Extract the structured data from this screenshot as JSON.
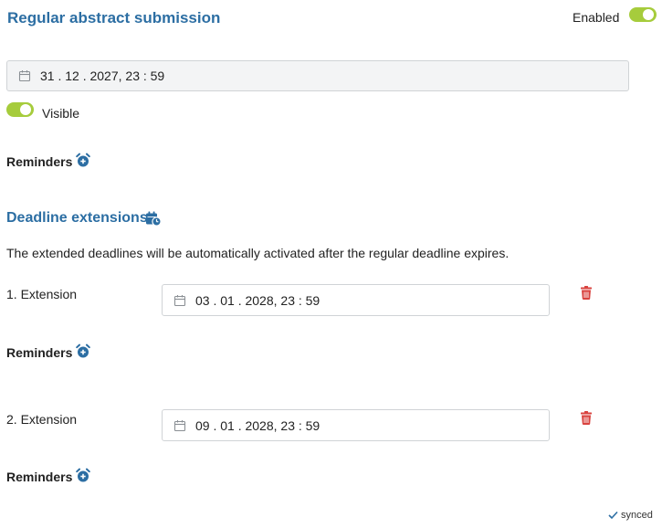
{
  "regular": {
    "title": "Regular abstract submission",
    "enabled_label": "Enabled",
    "enabled": true,
    "deadline_value": "31 . 12 . 2027, 23 : 59",
    "visible_label": "Visible",
    "visible": true,
    "reminders_label": "Reminders"
  },
  "extensions": {
    "title": "Deadline extensions",
    "description": "The extended deadlines will be automatically activated after the regular deadline expires.",
    "items": [
      {
        "label": "1. Extension",
        "deadline_value": "03 . 01 . 2028, 23 : 59",
        "reminders_label": "Reminders"
      },
      {
        "label": "2. Extension",
        "deadline_value": "09 . 01 . 2028, 23 : 59",
        "reminders_label": "Reminders"
      }
    ]
  },
  "status": {
    "synced_label": "synced"
  },
  "icons": {
    "calendar": "calendar-icon",
    "add_reminder": "alarm-clock-plus-icon",
    "add_extension": "calendar-clock-icon",
    "delete": "trash-icon",
    "synced": "check-icon"
  },
  "colors": {
    "accent": "#2c6ea3",
    "toggle_on": "#a6cc3c",
    "delete": "#d9433f",
    "field_border": "#d0d3d6",
    "field_disabled_bg": "#f3f4f5"
  }
}
